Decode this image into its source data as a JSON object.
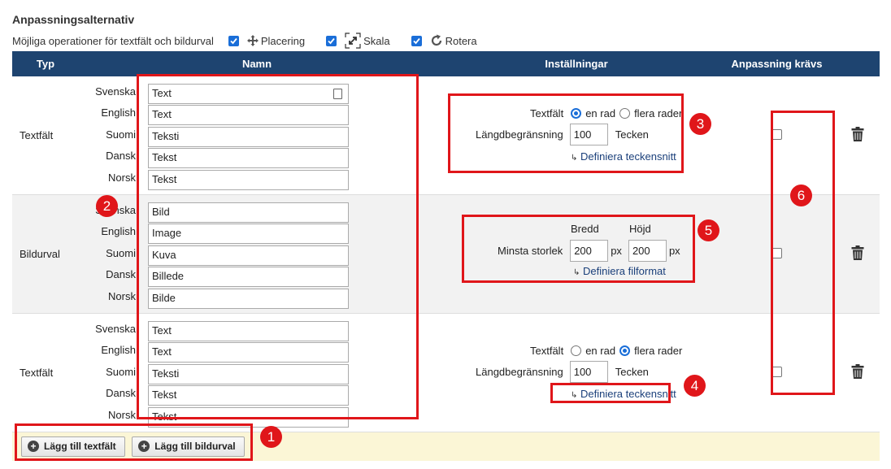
{
  "section_title": "Anpassningsalternativ",
  "operations": {
    "label": "Möjliga operationer för textfält och bildurval",
    "items": [
      {
        "label": "Placering",
        "checked": true
      },
      {
        "label": "Skala",
        "checked": true
      },
      {
        "label": "Rotera",
        "checked": true
      }
    ]
  },
  "table": {
    "headers": [
      "Typ",
      "Namn",
      "Inställningar",
      "Anpassning krävs"
    ],
    "rows": [
      {
        "type": "Textfält",
        "names": [
          {
            "lang": "Svenska",
            "value": "Text"
          },
          {
            "lang": "English",
            "value": "Text"
          },
          {
            "lang": "Suomi",
            "value": "Teksti"
          },
          {
            "lang": "Dansk",
            "value": "Tekst"
          },
          {
            "lang": "Norsk",
            "value": "Tekst"
          }
        ],
        "settings": {
          "textfield_label": "Textfält",
          "opt_single": "en rad",
          "opt_multi": "flera rader",
          "length_label": "Längdbegränsning",
          "length_value": "100",
          "length_unit": "Tecken",
          "link": "Definiera teckensnitt"
        },
        "required": false
      },
      {
        "type": "Bildurval",
        "names": [
          {
            "lang": "Svenska",
            "value": "Bild"
          },
          {
            "lang": "English",
            "value": "Image"
          },
          {
            "lang": "Suomi",
            "value": "Kuva"
          },
          {
            "lang": "Dansk",
            "value": "Billede"
          },
          {
            "lang": "Norsk",
            "value": "Bilde"
          }
        ],
        "settings": {
          "width_label": "Bredd",
          "height_label": "Höjd",
          "min_label": "Minsta storlek",
          "width_value": "200",
          "height_value": "200",
          "unit": "px",
          "link": "Definiera filformat"
        },
        "required": false
      },
      {
        "type": "Textfält",
        "names": [
          {
            "lang": "Svenska",
            "value": "Text"
          },
          {
            "lang": "English",
            "value": "Text"
          },
          {
            "lang": "Suomi",
            "value": "Teksti"
          },
          {
            "lang": "Dansk",
            "value": "Tekst"
          },
          {
            "lang": "Norsk",
            "value": "Tekst"
          }
        ],
        "settings": {
          "textfield_label": "Textfält",
          "opt_single": "en rad",
          "opt_multi": "flera rader",
          "length_label": "Längdbegränsning",
          "length_value": "100",
          "length_unit": "Tecken",
          "link": "Definiera teckensnitt"
        },
        "required": false
      }
    ]
  },
  "footer": {
    "add_textfield": "Lägg till textfält",
    "add_imagechoice": "Lägg till bildurval"
  },
  "badges": [
    "1",
    "2",
    "3",
    "4",
    "5",
    "6"
  ],
  "colors": {
    "header": "#1e4470",
    "accent": "#1a6ed8",
    "highlight": "#e0161a",
    "footer": "#fbf6d6"
  }
}
